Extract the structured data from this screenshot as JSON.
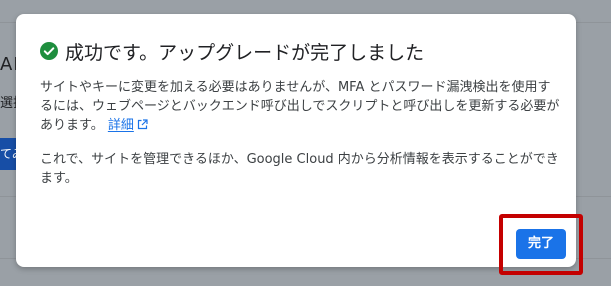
{
  "background": {
    "partial_heading": "AP",
    "partial_label": "選排",
    "partial_button": "てみ"
  },
  "dialog": {
    "title": "成功です。アップグレードが完了しました",
    "paragraph1": "サイトやキーに変更を加える必要はありませんが、MFA とパスワード漏洩検出を使用するには、ウェブページとバックエンド呼び出しでスクリプトと呼び出しを更新する必要があります。",
    "details_link": "詳細",
    "paragraph2": "これで、サイトを管理できるほか、Google Cloud 内から分析情報を表示することができます。",
    "done_button": "完了"
  },
  "colors": {
    "success_green": "#1e8e3e",
    "accent_blue": "#1a73e8",
    "highlight_red": "#c40000",
    "overlay": "#9aa0a6"
  },
  "icons": {
    "title": "check-circle-icon",
    "link": "external-link-icon"
  }
}
